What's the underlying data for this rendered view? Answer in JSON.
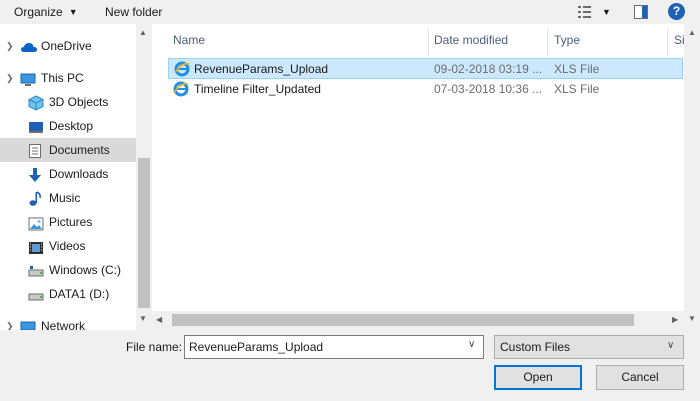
{
  "toolbar": {
    "organize_label": "Organize",
    "new_folder_label": "New folder",
    "help_label": "?"
  },
  "nav": {
    "items": [
      {
        "label": "OneDrive",
        "icon": "onedrive-icon",
        "expandable": true
      },
      {
        "label": "This PC",
        "icon": "computer-icon",
        "expandable": true
      },
      {
        "label": "3D Objects",
        "icon": "3d-objects-icon",
        "expandable": false
      },
      {
        "label": "Desktop",
        "icon": "desktop-icon",
        "expandable": false
      },
      {
        "label": "Documents",
        "icon": "documents-icon",
        "expandable": false,
        "selected": true
      },
      {
        "label": "Downloads",
        "icon": "downloads-icon",
        "expandable": false
      },
      {
        "label": "Music",
        "icon": "music-icon",
        "expandable": false
      },
      {
        "label": "Pictures",
        "icon": "pictures-icon",
        "expandable": false
      },
      {
        "label": "Videos",
        "icon": "videos-icon",
        "expandable": false
      },
      {
        "label": "Windows (C:)",
        "icon": "drive-icon",
        "expandable": false
      },
      {
        "label": "DATA1 (D:)",
        "icon": "drive-icon",
        "expandable": false
      },
      {
        "label": "Network",
        "icon": "network-icon",
        "expandable": true
      }
    ]
  },
  "list": {
    "columns": [
      "Name",
      "Date modified",
      "Type",
      "Size"
    ],
    "rows": [
      {
        "name": "RevenueParams_Upload",
        "date": "09-02-2018 03:19 ...",
        "type": "XLS File",
        "selected": true
      },
      {
        "name": "Timeline Filter_Updated",
        "date": "07-03-2018 10:36 ...",
        "type": "XLS File",
        "selected": false
      }
    ]
  },
  "bottom": {
    "file_name_label": "File name:",
    "file_name_value": "RevenueParams_Upload",
    "file_type_value": "Custom Files",
    "open_label": "Open",
    "cancel_label": "Cancel"
  },
  "colors": {
    "selection": "#cce8ff",
    "selection_border": "#99d1ff",
    "header_text": "#4c607a",
    "accent": "#0078d7"
  }
}
